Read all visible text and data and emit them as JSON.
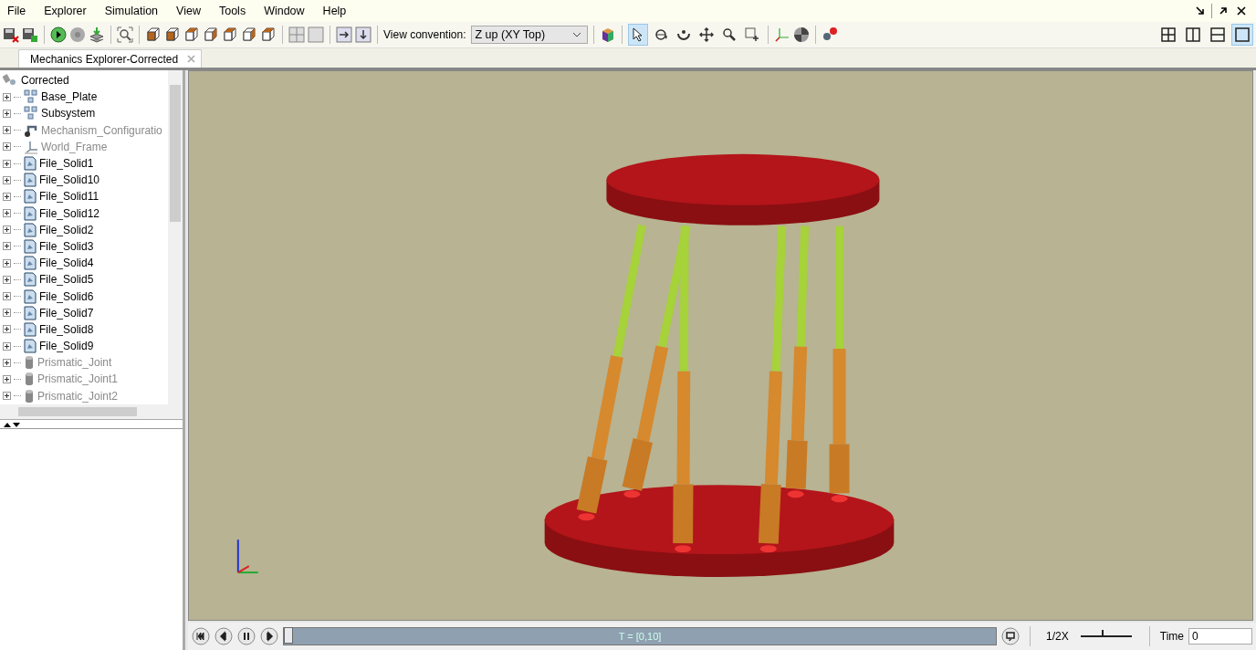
{
  "menu": [
    "File",
    "Explorer",
    "Simulation",
    "View",
    "Tools",
    "Window",
    "Help"
  ],
  "toolbar": {
    "view_convention_label": "View convention:",
    "view_convention": "Z up (XY Top)",
    "tools": [
      {
        "selected": true
      },
      {
        "selected": false
      },
      {
        "selected": false
      },
      {
        "selected": false
      },
      {
        "selected": false
      },
      {
        "selected": false
      }
    ]
  },
  "layout_buttons": [
    {
      "selected": false
    },
    {
      "selected": false
    },
    {
      "selected": false
    },
    {
      "selected": true
    }
  ],
  "tab": {
    "label": "Mechanics Explorer-Corrected",
    "selected": true
  },
  "tree": {
    "label": "Corrected",
    "children": [
      {
        "label": "Base_Plate",
        "kind": "subsystem",
        "disabled": false
      },
      {
        "label": "Subsystem",
        "kind": "subsystem",
        "disabled": false
      },
      {
        "label": "Mechanism_Configuratio",
        "kind": "config",
        "disabled": true
      },
      {
        "label": "World_Frame",
        "kind": "frame",
        "disabled": true
      },
      {
        "label": "File_Solid1",
        "kind": "solid",
        "disabled": false
      },
      {
        "label": "File_Solid10",
        "kind": "solid",
        "disabled": false
      },
      {
        "label": "File_Solid11",
        "kind": "solid",
        "disabled": false
      },
      {
        "label": "File_Solid12",
        "kind": "solid",
        "disabled": false
      },
      {
        "label": "File_Solid2",
        "kind": "solid",
        "disabled": false
      },
      {
        "label": "File_Solid3",
        "kind": "solid",
        "disabled": false
      },
      {
        "label": "File_Solid4",
        "kind": "solid",
        "disabled": false
      },
      {
        "label": "File_Solid5",
        "kind": "solid",
        "disabled": false
      },
      {
        "label": "File_Solid6",
        "kind": "solid",
        "disabled": false
      },
      {
        "label": "File_Solid7",
        "kind": "solid",
        "disabled": false
      },
      {
        "label": "File_Solid8",
        "kind": "solid",
        "disabled": false
      },
      {
        "label": "File_Solid9",
        "kind": "solid",
        "disabled": false
      },
      {
        "label": "Prismatic_Joint",
        "kind": "joint",
        "disabled": true
      },
      {
        "label": "Prismatic_Joint1",
        "kind": "joint",
        "disabled": true
      },
      {
        "label": "Prismatic_Joint2",
        "kind": "joint",
        "disabled": true
      }
    ]
  },
  "playback": {
    "range": "T = [0,10]",
    "level": 0,
    "speed": {
      "label": "1/2X",
      "level": 0.42
    },
    "time_label": "Time",
    "time_value": "0"
  }
}
